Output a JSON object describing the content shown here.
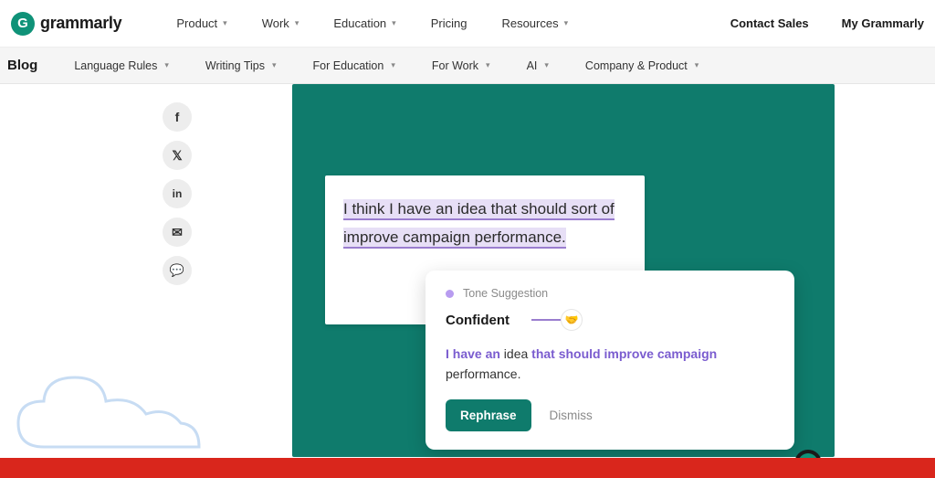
{
  "logo": {
    "glyph": "G",
    "text": "grammarly"
  },
  "topnav": [
    {
      "label": "Product",
      "has_chev": true
    },
    {
      "label": "Work",
      "has_chev": true
    },
    {
      "label": "Education",
      "has_chev": true
    },
    {
      "label": "Pricing",
      "has_chev": false
    },
    {
      "label": "Resources",
      "has_chev": true
    }
  ],
  "topnav_right": [
    {
      "label": "Contact Sales"
    },
    {
      "label": "My Grammarly"
    }
  ],
  "subnav": {
    "heading": "Blog",
    "items": [
      {
        "label": "Language Rules"
      },
      {
        "label": "Writing Tips"
      },
      {
        "label": "For Education"
      },
      {
        "label": "For Work"
      },
      {
        "label": "AI"
      },
      {
        "label": "Company & Product"
      }
    ]
  },
  "share": {
    "facebook": "f",
    "x": "𝕏",
    "linkedin": "in",
    "email": "✉",
    "messenger": "💬"
  },
  "hero": {
    "snippet": "I think I have an idea that should sort of improve campaign performance.",
    "suggestion": {
      "type_label": "Tone Suggestion",
      "title": "Confident",
      "emoji": "🤝",
      "rewrite_pre": "I have an",
      "rewrite_mid": " idea ",
      "rewrite_post1": "that should improve campaign",
      "rewrite_post2": " performance.",
      "rephrase": "Rephrase",
      "dismiss": "Dismiss"
    }
  },
  "colors": {
    "brand_green": "#0f7b6c",
    "accent_green": "#0f9278",
    "purple": "#7a5ccf",
    "red": "#d9261c"
  }
}
